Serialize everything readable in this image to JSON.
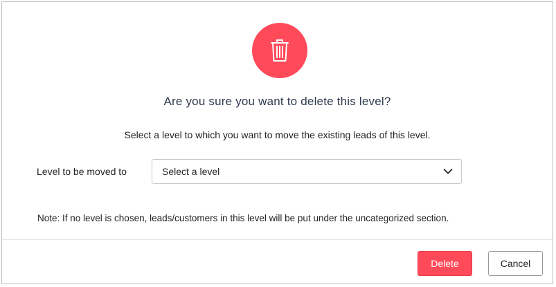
{
  "dialog": {
    "title": "Are you sure you want to delete this level?",
    "subtitle": "Select a level to which you want to move the existing leads of this level.",
    "field_label": "Level to be moved to",
    "select_value": "Select a level",
    "note": "Note: If no level is chosen, leads/customers in this level will be put under the uncategorized section.",
    "icon": "trash-icon",
    "accent_color": "#ff4a5a"
  },
  "footer": {
    "delete_label": "Delete",
    "cancel_label": "Cancel"
  }
}
